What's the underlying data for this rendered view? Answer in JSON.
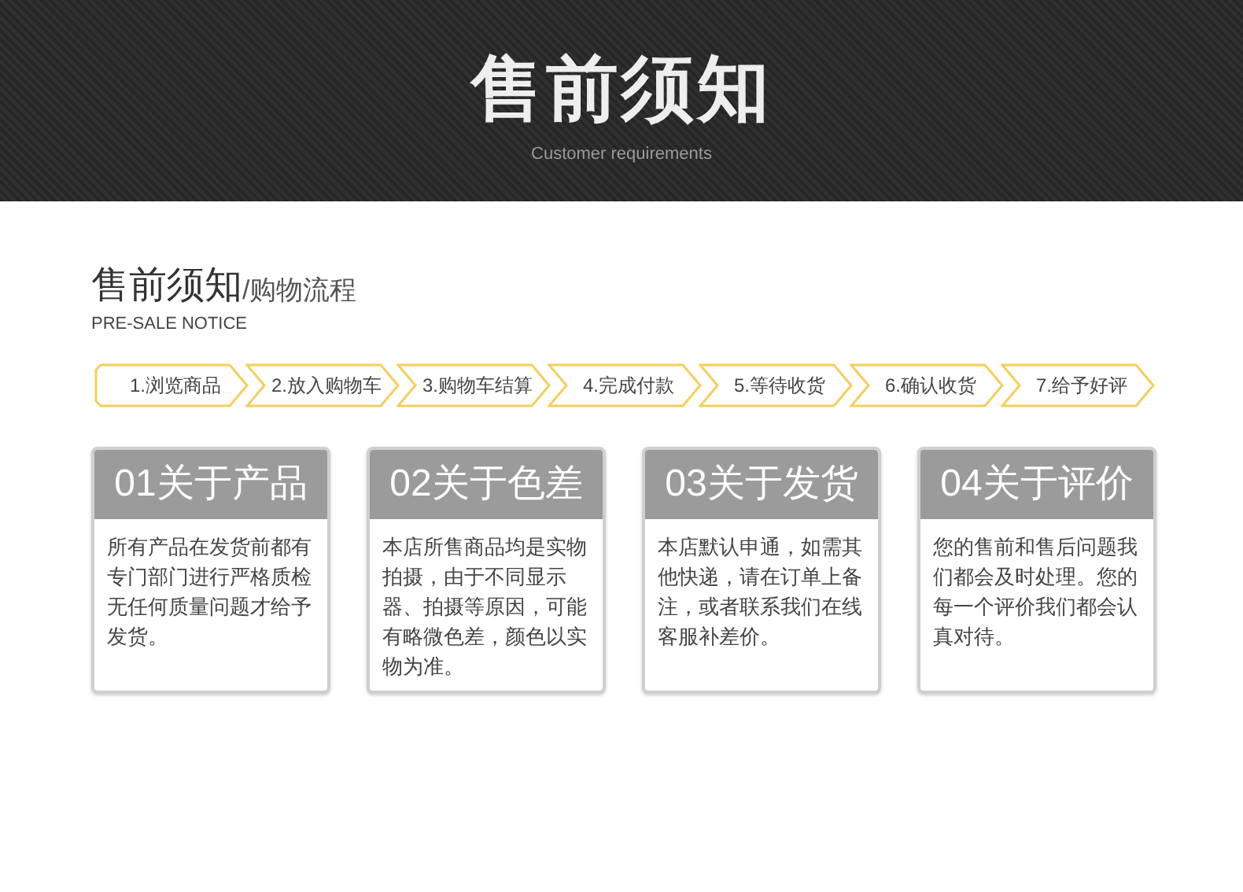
{
  "banner": {
    "title": "售前须知",
    "subtitle": "Customer requirements"
  },
  "section": {
    "title": "售前须知",
    "subtitle": "/购物流程",
    "english": "PRE-SALE NOTICE"
  },
  "steps": [
    "1.浏览商品",
    "2.放入购物车",
    "3.购物车结算",
    "4.完成付款",
    "5.等待收货",
    "6.确认收货",
    "7.给予好评"
  ],
  "cards": [
    {
      "title": "01关于产品",
      "body": "所有产品在发货前都有专门部门进行严格质检无任何质量问题才给予发货。"
    },
    {
      "title": "02关于色差",
      "body": "本店所售商品均是实物拍摄，由于不同显示器、拍摄等原因，可能有略微色差，颜色以实物为准。"
    },
    {
      "title": "03关于发货",
      "body": "本店默认申通，如需其他快递，请在订单上备注，或者联系我们在线客服补差价。"
    },
    {
      "title": "04关于评价",
      "body": "您的售前和售后问题我们都会及时处理。您的每一个评价我们都会认真对待。"
    }
  ]
}
